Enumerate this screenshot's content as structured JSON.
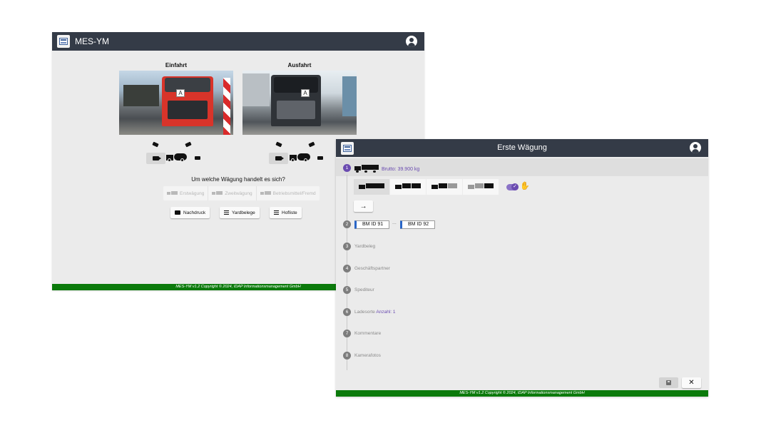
{
  "window1": {
    "app_title": "MES-YM",
    "cameras": {
      "entry_title": "Einfahrt",
      "exit_title": "Ausfahrt",
      "entry_plate": "A",
      "exit_plate": "A"
    },
    "question": "Um welche Wägung handelt es sich?",
    "weighing_options": [
      "Erstwägung",
      "Zweitwägung",
      "Betriebsmittel/Fremd"
    ],
    "actions": {
      "reprint": "Nachdruck",
      "yard_docs": "Yardbelege",
      "yard_list": "Hofliste"
    },
    "footer": "MES-YM v1.2 Copyright © 2024, IDAP Informationsmanagement GmbH"
  },
  "window2": {
    "app_title": "Erste Wägung",
    "steps": [
      {
        "num": "1",
        "label": "Brutto: 39.900 kg"
      },
      {
        "num": "2",
        "label": ""
      },
      {
        "num": "3",
        "label": "Yardbeleg"
      },
      {
        "num": "4",
        "label": "Geschäftspartner"
      },
      {
        "num": "5",
        "label": "Spediteur"
      },
      {
        "num": "6",
        "label": "Ladesorte",
        "extra": "Anzahl: 1"
      },
      {
        "num": "7",
        "label": "Kommentare"
      },
      {
        "num": "8",
        "label": "Kamerafotos"
      }
    ],
    "bm_ids": [
      "BM ID 91",
      "BM ID 92"
    ],
    "bm_separator": "...",
    "next_arrow": "→",
    "close_symbol": "✕",
    "toggle_on": true,
    "accent_color": "#6a4bb0",
    "footer": "MES-YM v1.2 Copyright © 2024, IDAP Informationsmanagement GmbH"
  }
}
